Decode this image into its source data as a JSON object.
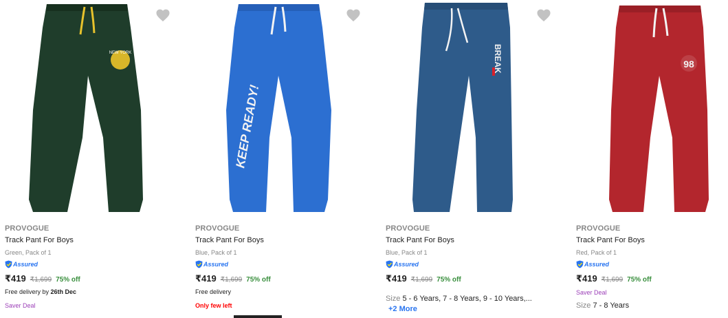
{
  "products": [
    {
      "brand": "PROVOGUE",
      "title": "Track Pant For Boys",
      "variant": "Green, Pack of 1",
      "assured": "Assured",
      "price": "₹419",
      "mrp": "₹1,699",
      "discount": "75% off",
      "delivery_prefix": "Free delivery by ",
      "delivery_date": "26th Dec",
      "tag": "Saver Deal",
      "color": "#1f3d2b"
    },
    {
      "brand": "PROVOGUE",
      "title": "Track Pant For Boys",
      "variant": "Blue, Pack of 1",
      "assured": "Assured",
      "price": "₹419",
      "mrp": "₹1,699",
      "discount": "75% off",
      "delivery": "Free delivery",
      "tag": "Only few left",
      "print_text": "KEEP READY!",
      "color": "#2c6fd1"
    },
    {
      "brand": "PROVOGUE",
      "title": "Track Pant For Boys",
      "variant": "Blue, Pack of 1",
      "assured": "Assured",
      "price": "₹419",
      "mrp": "₹1,699",
      "discount": "75% off",
      "size_label": "Size",
      "sizes": "5 - 6 Years, 7 - 8 Years, 9 - 10 Years,...",
      "more": "+2 More",
      "print_text": "BREAK",
      "color": "#2e5b8a"
    },
    {
      "brand": "PROVOGUE",
      "title": "Track Pant For Boys",
      "variant": "Red, Pack of 1",
      "assured": "Assured",
      "price": "₹419",
      "mrp": "₹1,699",
      "discount": "75% off",
      "tag": "Saver Deal",
      "size_label": "Size",
      "sizes": "7 - 8 Years",
      "print_text": "98",
      "color": "#b3262d"
    }
  ]
}
